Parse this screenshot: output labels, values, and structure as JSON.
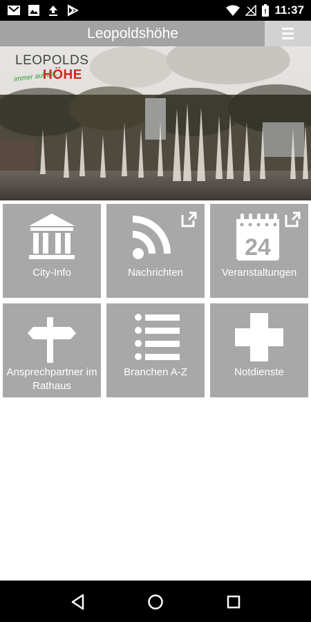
{
  "status_bar": {
    "time": "11:37",
    "left_icons": [
      "gmail-icon",
      "image-icon",
      "upload-icon",
      "play-store-icon"
    ],
    "right_icons": [
      "wifi-icon",
      "no-signal-icon",
      "battery-icon"
    ]
  },
  "app_bar": {
    "title": "Leopoldshöhe",
    "menu_icon": "hamburger-menu-icon"
  },
  "hero": {
    "logo_top": "LEOPOLDS",
    "logo_bottom": "HÖHE",
    "logo_tagline": "immer auf der..."
  },
  "tiles": [
    {
      "label": "City-Info",
      "icon": "building-icon",
      "external": false
    },
    {
      "label": "Nachrichten",
      "icon": "rss-icon",
      "external": true
    },
    {
      "label": "Veranstaltungen",
      "icon": "calendar-24-icon",
      "external": true
    },
    {
      "label": "Ansprechpartner im Rathaus",
      "icon": "signpost-icon",
      "external": false
    },
    {
      "label": "Branchen A-Z",
      "icon": "list-icon",
      "external": false
    },
    {
      "label": "Notdienste",
      "icon": "cross-icon",
      "external": false
    }
  ],
  "nav_bar": {
    "buttons": [
      "back-icon",
      "home-icon",
      "recents-icon"
    ]
  },
  "colors": {
    "app_bar": "#a3a3a3",
    "menu_button": "#d2d2d2",
    "tile": "#a8a8a8",
    "logo_red": "#d3261e",
    "logo_green": "#3a9a3a"
  }
}
